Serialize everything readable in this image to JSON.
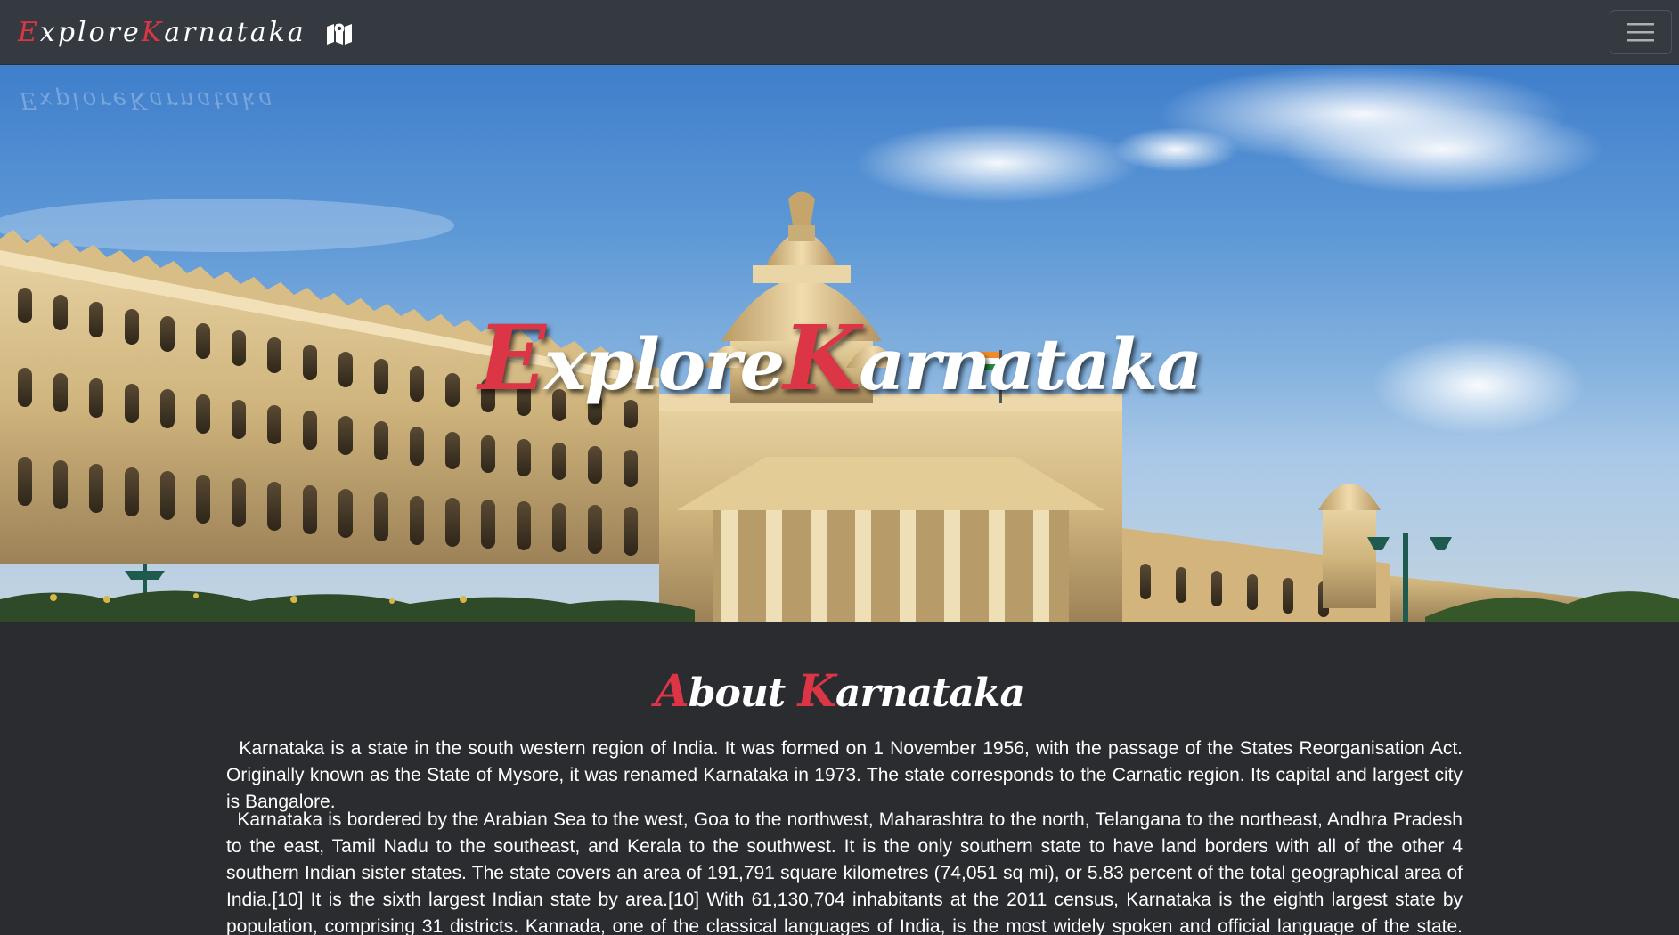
{
  "navbar": {
    "brand_first_letter": "E",
    "brand_rest_1": "xplore",
    "brand_second_letter": "K",
    "brand_rest_2": "arnataka",
    "brand_icon": "map-icon",
    "toggler_icon": "hamburger-menu-icon"
  },
  "hero": {
    "title_first_letter": "E",
    "title_rest_1": "xplore",
    "title_second_letter": "K",
    "title_rest_2": "arnataka"
  },
  "about": {
    "title_a": "A",
    "title_rest_1": "bout ",
    "title_k": "K",
    "title_rest_2": "arnataka",
    "paragraph_1": "Karnataka is a state in the south western region of India. It was formed on 1 November 1956, with the passage of the States Reorganisation Act. Originally known as the State of Mysore, it was renamed Karnataka in 1973. The state corresponds to the Carnatic region. Its capital and largest city is Bangalore.",
    "paragraph_2": "Karnataka is bordered by the Arabian Sea to the west, Goa to the northwest, Maharashtra to the north, Telangana to the northeast, Andhra Pradesh to the east, Tamil Nadu to the southeast, and Kerala to the southwest. It is the only southern state to have land borders with all of the other 4 southern Indian sister states. The state covers an area of 191,791 square kilometres (74,051 sq mi), or 5.83 percent of the total geographical area of India.[10] It is the sixth largest Indian state by area.[10] With 61,130,704 inhabitants at the 2011 census, Karnataka is the eighth largest state by population, comprising 31 districts. Kannada, one of the classical languages of India, is the most widely spoken and official language of the state. Other minority languages spoken include Urdu, Konkani,"
  },
  "colors": {
    "accent": "#dc3545",
    "navbar_bg": "#343a40",
    "page_bg": "#2b2c2f",
    "text": "#ffffff"
  }
}
